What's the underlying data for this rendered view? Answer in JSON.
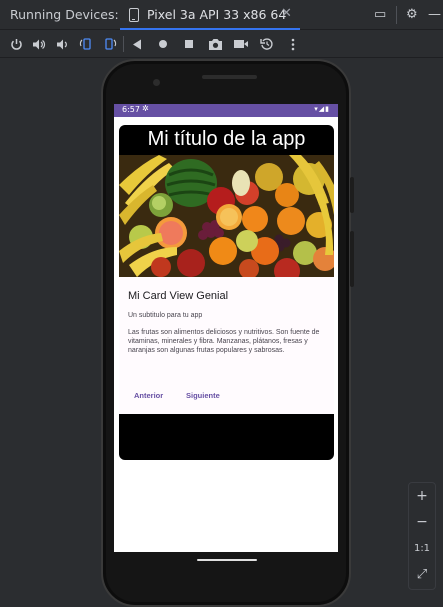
{
  "panel": {
    "title": "Running Devices:"
  },
  "tab": {
    "label": "Pixel 3a API 33 x86 64",
    "close": "✕"
  },
  "window_actions": {
    "restore": "▭",
    "settings": "⚙",
    "minimize": "—"
  },
  "toolbar": {
    "icons": [
      "power-icon",
      "volume-up-icon",
      "volume-down-icon",
      "rotate-left-icon",
      "rotate-right-icon",
      "back-icon",
      "home-icon",
      "overview-icon",
      "screenshot-icon",
      "screen-record-icon",
      "snapshot-icon",
      "more-icon"
    ]
  },
  "device": {
    "status_time": "6:57",
    "app": {
      "title": "Mi título de la app",
      "card_title": "Mi Card View Genial",
      "subtitle": "Un subtitulo para tu app",
      "body": "Las frutas son alimentos deliciosos y nutritivos. Son fuente de vitaminas, minerales y fibra. Manzanas, plátanos, fresas y naranjas son algunas frutas populares y sabrosas.",
      "prev_button": "Anterior",
      "next_button": "Siguiente"
    }
  },
  "zoom": {
    "in": "+",
    "out": "−",
    "actual": "1:1",
    "fit": "⤢"
  },
  "colors": {
    "accent": "#3574f0",
    "status_bar": "#6650a4",
    "button_text": "#6750a4"
  }
}
